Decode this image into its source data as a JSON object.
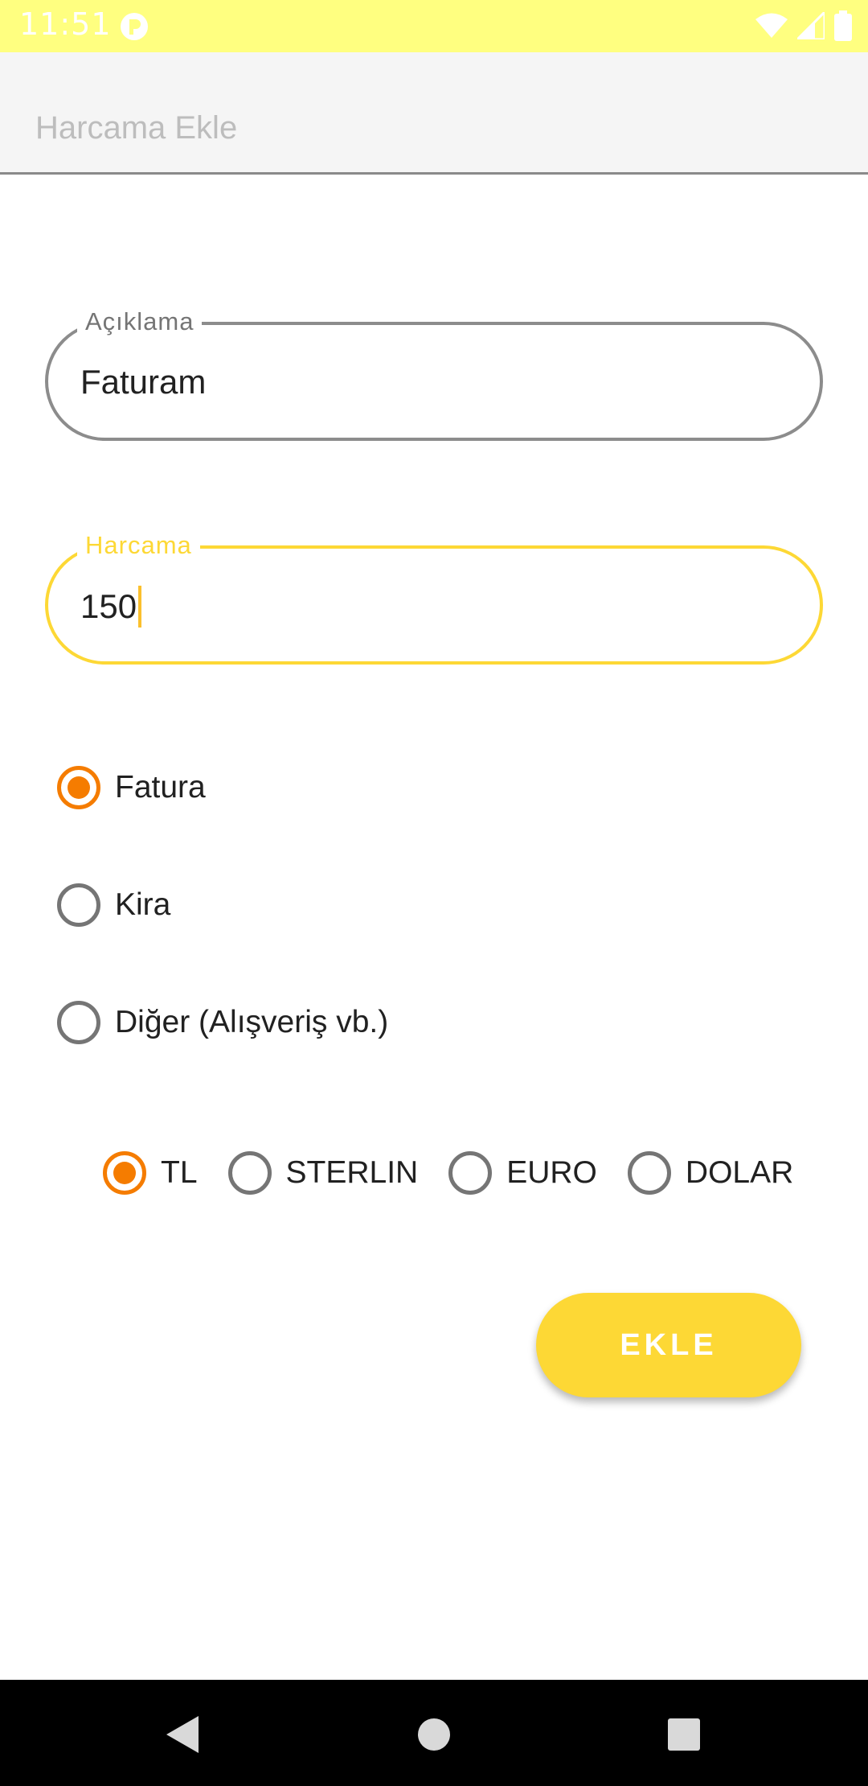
{
  "status_bar": {
    "time": "11:51",
    "background_color": "#ffff80",
    "icons": [
      "app-notification-icon",
      "wifi-icon",
      "signal-icon",
      "battery-icon"
    ]
  },
  "app_bar": {
    "title": "Harcama Ekle"
  },
  "description_field": {
    "label": "Açıklama",
    "value": "Faturam"
  },
  "amount_field": {
    "label": "Harcama",
    "value": "150",
    "accent_color": "#fdd835"
  },
  "category_options": [
    {
      "label": "Fatura",
      "checked": true
    },
    {
      "label": "Kira",
      "checked": false
    },
    {
      "label": "Diğer (Alışveriş vb.)",
      "checked": false
    }
  ],
  "currency_options": [
    {
      "label": "TL",
      "checked": true
    },
    {
      "label": "STERLIN",
      "checked": false
    },
    {
      "label": "EURO",
      "checked": false
    },
    {
      "label": "DOLAR",
      "checked": false
    }
  ],
  "add_button": {
    "label": "EKLE",
    "color": "#fdd835"
  },
  "colors": {
    "radio_checked": "#f57c00",
    "radio_unchecked": "#757575"
  },
  "nav_bar": {
    "icons": [
      "back-icon",
      "home-icon",
      "recents-icon"
    ]
  }
}
